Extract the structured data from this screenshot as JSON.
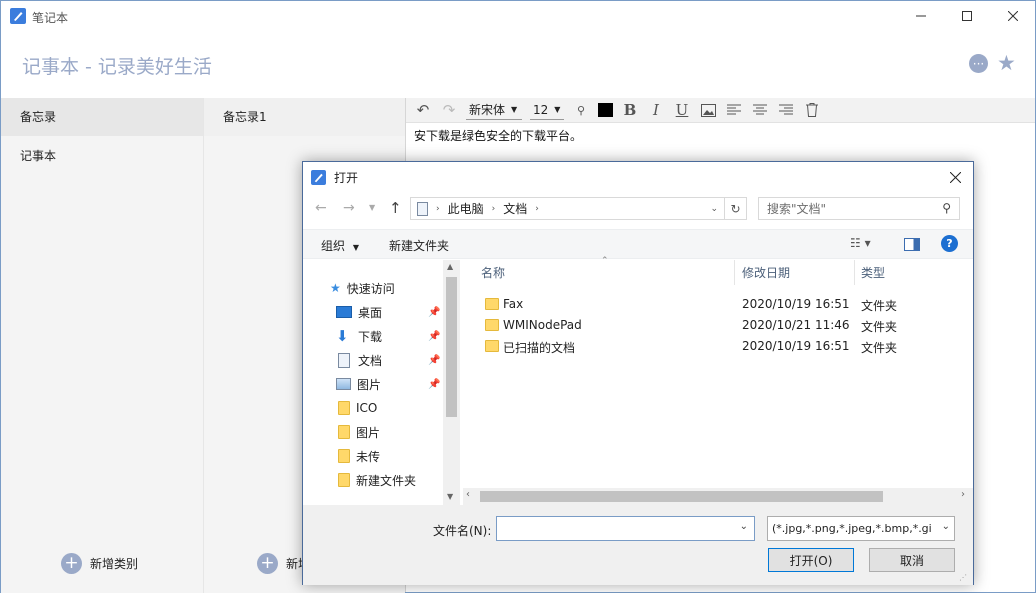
{
  "app": {
    "window_title": "笔记本",
    "header_title": "记事本 - 记录美好生活"
  },
  "categories": {
    "header": "备忘录",
    "items": [
      "记事本"
    ],
    "add_label": "新增类别"
  },
  "notes": {
    "header": "备忘录1",
    "add_label": "新增"
  },
  "editor": {
    "font": "新宋体",
    "size": "12",
    "content": "安下载是绿色安全的下载平台。"
  },
  "dialog": {
    "title": "打开",
    "breadcrumb": [
      "此电脑",
      "文档"
    ],
    "search_placeholder": "搜索\"文档\"",
    "organize_label": "组织",
    "new_folder_label": "新建文件夹",
    "nav_items": [
      {
        "label": "快速访问",
        "icon": "star-icon"
      },
      {
        "label": "桌面",
        "icon": "desktop-icon",
        "pinned": true
      },
      {
        "label": "下载",
        "icon": "download-icon",
        "pinned": true
      },
      {
        "label": "文档",
        "icon": "document-icon",
        "pinned": true
      },
      {
        "label": "图片",
        "icon": "pictures-icon",
        "pinned": true
      },
      {
        "label": "ICO",
        "icon": "folder-icon"
      },
      {
        "label": "图片",
        "icon": "folder-icon"
      },
      {
        "label": "未传",
        "icon": "folder-icon"
      },
      {
        "label": "新建文件夹",
        "icon": "folder-icon"
      }
    ],
    "columns": {
      "name": "名称",
      "modified": "修改日期",
      "type": "类型"
    },
    "files": [
      {
        "name": "Fax",
        "modified": "2020/10/19 16:51",
        "type": "文件夹"
      },
      {
        "name": "WMINodePad",
        "modified": "2020/10/21 11:46",
        "type": "文件夹"
      },
      {
        "name": "已扫描的文档",
        "modified": "2020/10/19 16:51",
        "type": "文件夹"
      }
    ],
    "filename_label": "文件名(N):",
    "filename_value": "",
    "filter_value": "(*.jpg,*.png,*.jpeg,*.bmp,*.gi",
    "open_label": "打开(O)",
    "cancel_label": "取消"
  },
  "colors": {
    "accent": "#9aa9c8",
    "dialog_border": "#4a6a9a",
    "open_button_border": "#0078d7"
  }
}
